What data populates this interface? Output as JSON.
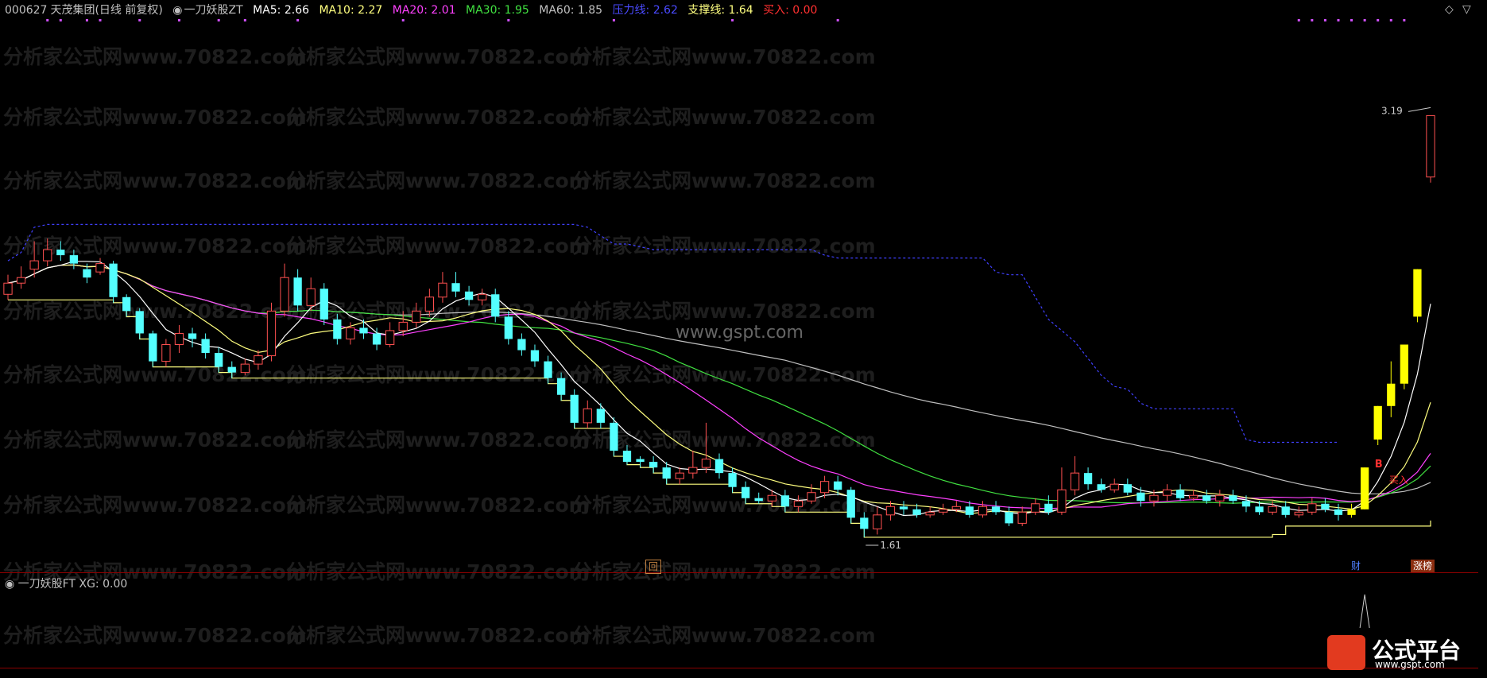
{
  "header": {
    "stock_code": "000627",
    "stock_name": "天茂集团",
    "period": "(日线 前复权)",
    "indicator_name": "一刀妖股ZT",
    "ma5": "MA5: 2.66",
    "ma10": "MA10: 2.27",
    "ma20": "MA20: 2.01",
    "ma30": "MA30: 1.95",
    "ma60": "MA60: 1.85",
    "pressure": "压力线: 2.62",
    "support": "支撑线: 1.64",
    "buy": "买入: 0.00"
  },
  "sub_header": {
    "indicator_name": "一刀妖股FT",
    "xg": "XG: 0.00"
  },
  "labels": {
    "high_price": "3.19",
    "low_price": "1.61",
    "buy_marker": "买入",
    "b_marker": "B",
    "hui_badge": "回",
    "cai_badge": "财",
    "zhangting_badge": "涨榜",
    "site_watermark": "www.gspt.com"
  },
  "watermark_text": "分析家公式网www.70822.com",
  "brand": {
    "name": "公式平台",
    "url": "www.gspt.com"
  },
  "colors": {
    "up_candle": "#ff5050",
    "down_candle": "#54ffff",
    "limit_up": "#ffff00",
    "ma5": "#ffffff",
    "ma10": "#ffff7f",
    "ma20": "#ff40ff",
    "ma30": "#40e040",
    "ma60": "#c0c0c0",
    "pressure": "#4040ff",
    "support": "#ffff80",
    "buy": "#ff3030"
  },
  "chart_data": {
    "type": "candlestick",
    "y_range": [
      1.45,
      3.3
    ],
    "candles": [
      [
        2.36,
        2.4,
        2.43,
        2.34
      ],
      [
        2.4,
        2.42,
        2.46,
        2.38
      ],
      [
        2.45,
        2.48,
        2.55,
        2.42
      ],
      [
        2.48,
        2.52,
        2.56,
        2.46
      ],
      [
        2.52,
        2.5,
        2.55,
        2.48
      ],
      [
        2.5,
        2.47,
        2.52,
        2.45
      ],
      [
        2.45,
        2.42,
        2.47,
        2.4
      ],
      [
        2.44,
        2.47,
        2.49,
        2.43
      ],
      [
        2.47,
        2.35,
        2.48,
        2.33
      ],
      [
        2.35,
        2.3,
        2.36,
        2.28
      ],
      [
        2.3,
        2.22,
        2.31,
        2.2
      ],
      [
        2.22,
        2.12,
        2.23,
        2.1
      ],
      [
        2.12,
        2.18,
        2.2,
        2.1
      ],
      [
        2.18,
        2.22,
        2.25,
        2.15
      ],
      [
        2.22,
        2.2,
        2.24,
        2.17
      ],
      [
        2.2,
        2.15,
        2.22,
        2.13
      ],
      [
        2.15,
        2.1,
        2.17,
        2.08
      ],
      [
        2.1,
        2.08,
        2.12,
        2.06
      ],
      [
        2.08,
        2.11,
        2.13,
        2.07
      ],
      [
        2.11,
        2.14,
        2.16,
        2.09
      ],
      [
        2.14,
        2.3,
        2.33,
        2.12
      ],
      [
        2.3,
        2.42,
        2.47,
        2.28
      ],
      [
        2.42,
        2.32,
        2.45,
        2.3
      ],
      [
        2.32,
        2.38,
        2.42,
        2.3
      ],
      [
        2.38,
        2.27,
        2.4,
        2.25
      ],
      [
        2.27,
        2.2,
        2.29,
        2.18
      ],
      [
        2.2,
        2.24,
        2.26,
        2.18
      ],
      [
        2.24,
        2.22,
        2.27,
        2.2
      ],
      [
        2.22,
        2.18,
        2.24,
        2.16
      ],
      [
        2.18,
        2.23,
        2.26,
        2.17
      ],
      [
        2.23,
        2.26,
        2.3,
        2.21
      ],
      [
        2.26,
        2.3,
        2.33,
        2.24
      ],
      [
        2.3,
        2.35,
        2.38,
        2.28
      ],
      [
        2.35,
        2.4,
        2.44,
        2.33
      ],
      [
        2.4,
        2.37,
        2.44,
        2.35
      ],
      [
        2.37,
        2.34,
        2.39,
        2.32
      ],
      [
        2.34,
        2.36,
        2.38,
        2.32
      ],
      [
        2.36,
        2.28,
        2.38,
        2.26
      ],
      [
        2.28,
        2.2,
        2.3,
        2.18
      ],
      [
        2.2,
        2.16,
        2.22,
        2.14
      ],
      [
        2.16,
        2.12,
        2.18,
        2.1
      ],
      [
        2.12,
        2.06,
        2.14,
        2.04
      ],
      [
        2.06,
        2.0,
        2.08,
        1.98
      ],
      [
        2.0,
        1.9,
        2.02,
        1.88
      ],
      [
        1.9,
        1.95,
        1.98,
        1.88
      ],
      [
        1.95,
        1.9,
        1.97,
        1.88
      ],
      [
        1.9,
        1.8,
        1.92,
        1.78
      ],
      [
        1.8,
        1.76,
        1.82,
        1.75
      ],
      [
        1.77,
        1.76,
        1.78,
        1.74
      ],
      [
        1.76,
        1.74,
        1.78,
        1.72
      ],
      [
        1.74,
        1.7,
        1.76,
        1.68
      ],
      [
        1.7,
        1.72,
        1.74,
        1.68
      ],
      [
        1.72,
        1.74,
        1.8,
        1.7
      ],
      [
        1.74,
        1.77,
        1.9,
        1.72
      ],
      [
        1.77,
        1.72,
        1.79,
        1.7
      ],
      [
        1.72,
        1.67,
        1.74,
        1.65
      ],
      [
        1.67,
        1.63,
        1.69,
        1.61
      ],
      [
        1.63,
        1.62,
        1.65,
        1.61
      ],
      [
        1.62,
        1.64,
        1.66,
        1.6
      ],
      [
        1.64,
        1.6,
        1.66,
        1.58
      ],
      [
        1.6,
        1.62,
        1.64,
        1.58
      ],
      [
        1.62,
        1.65,
        1.68,
        1.61
      ],
      [
        1.65,
        1.69,
        1.71,
        1.63
      ],
      [
        1.69,
        1.66,
        1.71,
        1.64
      ],
      [
        1.66,
        1.56,
        1.67,
        1.54
      ],
      [
        1.56,
        1.52,
        1.58,
        1.49
      ],
      [
        1.52,
        1.57,
        1.6,
        1.5
      ],
      [
        1.57,
        1.6,
        1.62,
        1.55
      ],
      [
        1.6,
        1.59,
        1.62,
        1.57
      ],
      [
        1.59,
        1.57,
        1.61,
        1.56
      ],
      [
        1.57,
        1.58,
        1.6,
        1.56
      ],
      [
        1.58,
        1.59,
        1.61,
        1.57
      ],
      [
        1.59,
        1.6,
        1.62,
        1.58
      ],
      [
        1.6,
        1.57,
        1.62,
        1.56
      ],
      [
        1.57,
        1.6,
        1.62,
        1.56
      ],
      [
        1.6,
        1.58,
        1.62,
        1.57
      ],
      [
        1.58,
        1.54,
        1.6,
        1.53
      ],
      [
        1.54,
        1.58,
        1.6,
        1.53
      ],
      [
        1.58,
        1.61,
        1.63,
        1.57
      ],
      [
        1.61,
        1.58,
        1.64,
        1.57
      ],
      [
        1.58,
        1.66,
        1.74,
        1.57
      ],
      [
        1.66,
        1.72,
        1.78,
        1.64
      ],
      [
        1.72,
        1.68,
        1.74,
        1.66
      ],
      [
        1.68,
        1.66,
        1.7,
        1.65
      ],
      [
        1.66,
        1.68,
        1.7,
        1.65
      ],
      [
        1.68,
        1.65,
        1.7,
        1.64
      ],
      [
        1.65,
        1.62,
        1.67,
        1.6
      ],
      [
        1.62,
        1.64,
        1.66,
        1.6
      ],
      [
        1.64,
        1.66,
        1.68,
        1.62
      ],
      [
        1.66,
        1.63,
        1.68,
        1.62
      ],
      [
        1.63,
        1.64,
        1.66,
        1.62
      ],
      [
        1.64,
        1.62,
        1.66,
        1.61
      ],
      [
        1.62,
        1.64,
        1.66,
        1.6
      ],
      [
        1.64,
        1.62,
        1.66,
        1.61
      ],
      [
        1.62,
        1.6,
        1.64,
        1.58
      ],
      [
        1.6,
        1.58,
        1.62,
        1.57
      ],
      [
        1.58,
        1.6,
        1.62,
        1.57
      ],
      [
        1.6,
        1.57,
        1.62,
        1.56
      ],
      [
        1.57,
        1.58,
        1.6,
        1.56
      ],
      [
        1.58,
        1.61,
        1.63,
        1.57
      ],
      [
        1.61,
        1.59,
        1.63,
        1.58
      ],
      [
        1.59,
        1.57,
        1.61,
        1.55
      ],
      [
        1.57,
        1.59,
        1.61,
        1.56
      ],
      [
        1.59,
        1.74,
        1.74,
        1.59
      ],
      [
        1.84,
        1.96,
        1.96,
        1.82
      ],
      [
        1.96,
        2.04,
        2.12,
        1.92
      ],
      [
        2.04,
        2.18,
        2.18,
        2.02
      ],
      [
        2.28,
        2.45,
        2.45,
        2.26
      ],
      [
        2.78,
        3.0,
        3.0,
        2.76
      ]
    ],
    "limit_up_indices": [
      102,
      103,
      104,
      105,
      106,
      107
    ]
  }
}
